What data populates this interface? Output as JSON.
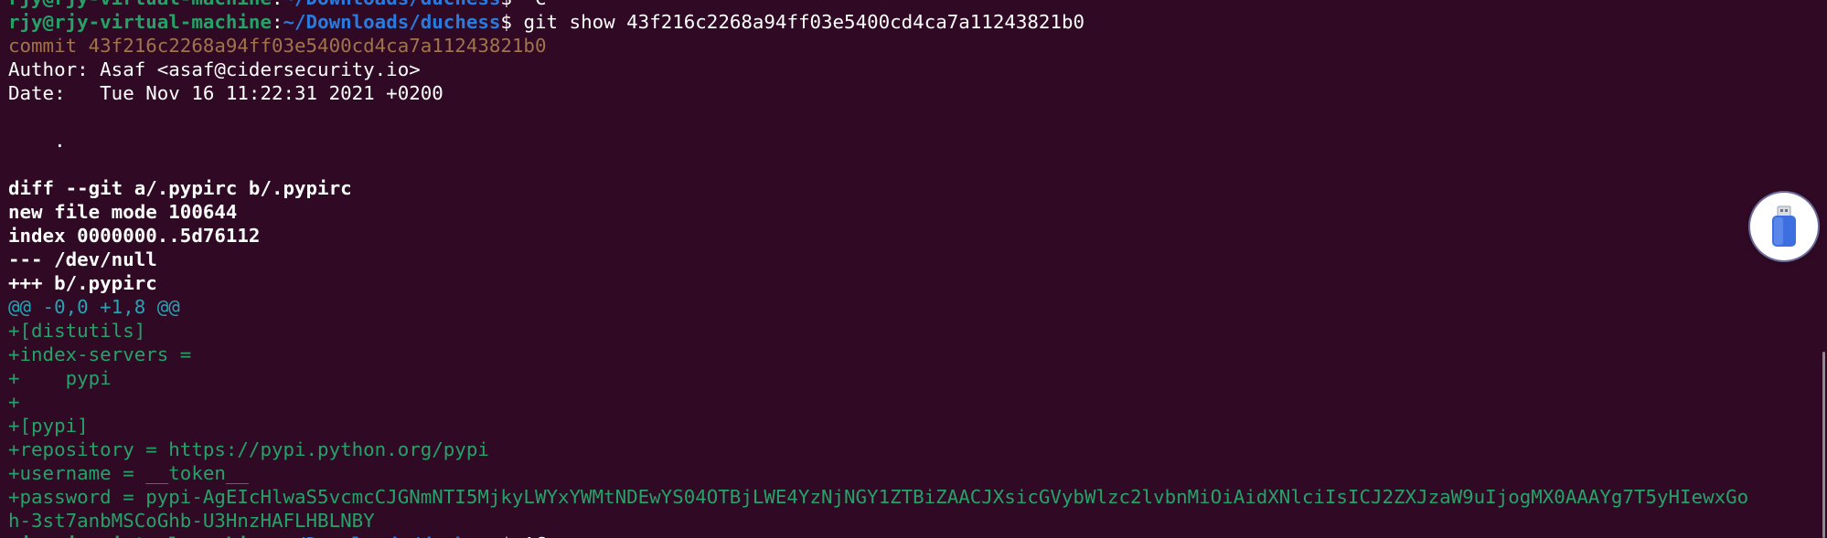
{
  "terminal": {
    "lines": [
      [
        {
          "t": "rjy@rjy-virtual-machine",
          "c": "green-bold"
        },
        {
          "t": ":",
          "c": "white"
        },
        {
          "t": "~/Downloads/duchess",
          "c": "blue-bold"
        },
        {
          "t": "$ ^C",
          "c": "white"
        }
      ],
      [
        {
          "t": "rjy@rjy-virtual-machine",
          "c": "green-bold"
        },
        {
          "t": ":",
          "c": "white"
        },
        {
          "t": "~/Downloads/duchess",
          "c": "blue-bold"
        },
        {
          "t": "$ git show 43f216c2268a94ff03e5400cd4ca7a11243821b0",
          "c": "white"
        }
      ],
      [
        {
          "t": "commit 43f216c2268a94ff03e5400cd4ca7a11243821b0",
          "c": "commit"
        }
      ],
      [
        {
          "t": "Author: Asaf <asaf@cidersecurity.io>",
          "c": "white"
        }
      ],
      [
        {
          "t": "Date:   Tue Nov 16 11:22:31 2021 +0200",
          "c": "white"
        }
      ],
      [
        {
          "t": "",
          "c": "white"
        }
      ],
      [
        {
          "t": "    .",
          "c": "white"
        }
      ],
      [
        {
          "t": "",
          "c": "white"
        }
      ],
      [
        {
          "t": "diff --git a/.pypirc b/.pypirc",
          "c": "bold"
        }
      ],
      [
        {
          "t": "new file mode 100644",
          "c": "bold"
        }
      ],
      [
        {
          "t": "index 0000000..5d76112",
          "c": "bold"
        }
      ],
      [
        {
          "t": "--- /dev/null",
          "c": "bold"
        }
      ],
      [
        {
          "t": "+++ b/.pypirc",
          "c": "bold"
        }
      ],
      [
        {
          "t": "@@ -0,0 +1,8 @@",
          "c": "hunk"
        }
      ],
      [
        {
          "t": "+[distutils]",
          "c": "added"
        }
      ],
      [
        {
          "t": "+index-servers =",
          "c": "added"
        }
      ],
      [
        {
          "t": "+    pypi",
          "c": "added"
        }
      ],
      [
        {
          "t": "+",
          "c": "added"
        }
      ],
      [
        {
          "t": "+[pypi]",
          "c": "added"
        }
      ],
      [
        {
          "t": "+repository = https://pypi.python.org/pypi",
          "c": "added"
        }
      ],
      [
        {
          "t": "+username = __token__",
          "c": "added"
        }
      ],
      [
        {
          "t": "+password = pypi-AgEIcHlwaS5vcmcCJGNmNTI5MjkyLWYxYWMtNDEwYS04OTBjLWE4YzNjNGY1ZTBiZAACJXsicGVybWlzc2lvbnMiOiAidXNlciIsICJ2ZXJzaW9uIjogMX0AAAYg7T5yHIewxGo",
          "c": "added"
        }
      ],
      [
        {
          "t": "h-3st7anbMSCoGhb-U3HnzHAFLHBLNBY",
          "c": "added"
        }
      ],
      [
        {
          "t": "rjy@rjy-virtual-machine",
          "c": "green-bold"
        },
        {
          "t": ":",
          "c": "white"
        },
        {
          "t": "~/Downloads/duchess",
          "c": "blue-bold"
        },
        {
          "t": "$ ^C",
          "c": "white"
        }
      ]
    ]
  },
  "widgets": {
    "usb_icon": "usb-drive-icon"
  },
  "colors": {
    "background": "#300a24",
    "prompt_user": "#26a269",
    "prompt_path": "#2a7bde",
    "commit_hash": "#a2734c",
    "hunk_header": "#2aa1b3",
    "added_line": "#26a269"
  }
}
